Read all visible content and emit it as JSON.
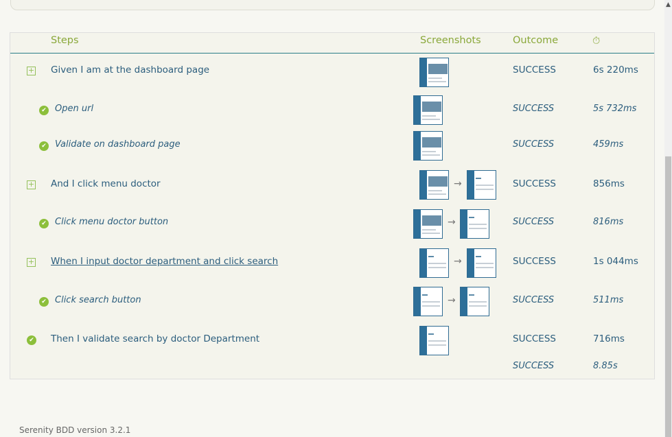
{
  "table": {
    "headers": {
      "steps": "Steps",
      "screenshots": "Screenshots",
      "outcome": "Outcome",
      "duration": "⏱"
    },
    "rows": [
      {
        "step": "Given I am at the dashboard page",
        "outcome": "SUCCESS",
        "duration": "6s 220ms",
        "icon": "expand-icon",
        "link": false
      },
      {
        "step": "Open url",
        "outcome": "SUCCESS",
        "duration": "5s 732ms",
        "icon": "check-icon"
      },
      {
        "step": "Validate on dashboard page",
        "outcome": "SUCCESS",
        "duration": "459ms",
        "icon": "check-icon"
      },
      {
        "step": "And I click menu doctor",
        "outcome": "SUCCESS",
        "duration": "856ms",
        "icon": "expand-icon",
        "link": false
      },
      {
        "step": "Click menu doctor button",
        "outcome": "SUCCESS",
        "duration": "816ms",
        "icon": "check-icon"
      },
      {
        "step": "When I input doctor department and click search",
        "outcome": "SUCCESS",
        "duration": "1s 044ms",
        "icon": "expand-icon",
        "link": true
      },
      {
        "step": "Click search button",
        "outcome": "SUCCESS",
        "duration": "511ms",
        "icon": "check-icon"
      },
      {
        "step": "Then I validate search by doctor Department",
        "outcome": "SUCCESS",
        "duration": "716ms",
        "icon": "check-icon"
      }
    ],
    "total": {
      "outcome": "SUCCESS",
      "duration": "8.85s"
    }
  },
  "footer": {
    "version": "Serenity BDD version 3.2.1"
  },
  "colors": {
    "accent": "#8aa83a",
    "text": "#2b5d7d",
    "success": "#8cbf3b",
    "divider": "#2a7d88"
  }
}
